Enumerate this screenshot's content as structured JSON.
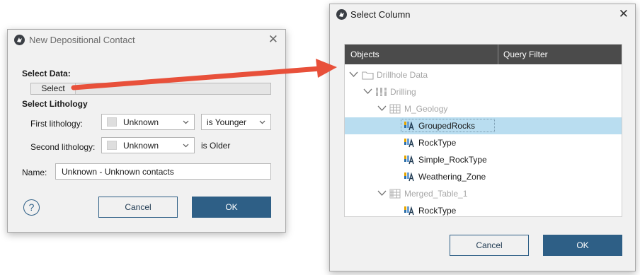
{
  "dialog_left": {
    "title": "New Depositional Contact",
    "close_glyph": "✕",
    "select_data_label": "Select Data:",
    "select_button_label": "Select",
    "select_lithology_label": "Select Lithology",
    "first_lithology_label": "First lithology:",
    "first_lithology_value": "Unknown",
    "relation_value": "is Younger",
    "second_lithology_label": "Second lithology:",
    "second_lithology_value": "Unknown",
    "is_older_text": "is Older",
    "name_label": "Name:",
    "name_value": "Unknown - Unknown contacts",
    "help_glyph": "?",
    "cancel_label": "Cancel",
    "ok_label": "OK"
  },
  "dialog_right": {
    "title": "Select Column",
    "close_glyph": "✕",
    "columns": [
      "Objects",
      "Query Filter"
    ],
    "tree": [
      {
        "label": "Drillhole Data",
        "icon": "folder-icon",
        "expanded": true,
        "dim": true
      },
      {
        "label": "Drilling",
        "icon": "drillholes-icon",
        "expanded": true,
        "dim": true
      },
      {
        "label": "M_Geology",
        "icon": "table-icon",
        "expanded": true,
        "dim": true
      },
      {
        "label": "GroupedRocks",
        "icon": "category-column-icon",
        "selected": true
      },
      {
        "label": "RockType",
        "icon": "category-column-icon"
      },
      {
        "label": "Simple_RockType",
        "icon": "category-column-icon"
      },
      {
        "label": "Weathering_Zone",
        "icon": "category-column-icon"
      },
      {
        "label": "Merged_Table_1",
        "icon": "merged-table-icon",
        "expanded": true,
        "dim": true
      },
      {
        "label": "RockType",
        "icon": "category-column-icon"
      }
    ],
    "cancel_label": "Cancel",
    "ok_label": "OK"
  },
  "colors": {
    "accent": "#2e5f86",
    "selection": "#b9ddf0",
    "arrow": "#e8503a",
    "header": "#4b4b4b"
  }
}
